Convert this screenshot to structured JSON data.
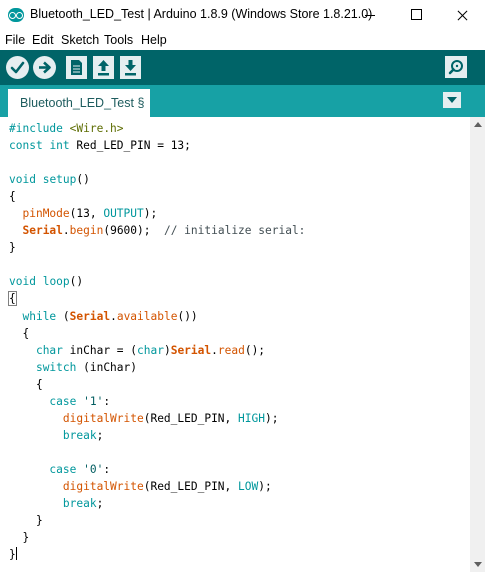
{
  "window": {
    "title": "Bluetooth_LED_Test | Arduino 1.8.9 (Windows Store 1.8.21.0)",
    "icon": "arduino-logo-icon",
    "controls": [
      "minimize-icon",
      "maximize-icon",
      "close-icon"
    ]
  },
  "menu": {
    "file": "File",
    "edit": "Edit",
    "sketch": "Sketch",
    "tools": "Tools",
    "help": "Help"
  },
  "toolbar": {
    "buttons": [
      "verify-icon",
      "upload-arrow-icon",
      "new-file-icon",
      "open-icon",
      "save-icon"
    ],
    "right_button": "serial-monitor-icon"
  },
  "tabs": [
    {
      "label": "Bluetooth_LED_Test §",
      "active": true
    }
  ],
  "editor": {
    "lines": [
      "#include <Wire.h>",
      "const int Red_LED_PIN = 13;",
      "",
      "void setup()",
      "{",
      "  pinMode(13, OUTPUT);",
      "  Serial.begin(9600);  // initialize serial:",
      "}",
      "",
      "void loop()",
      "{",
      "  while (Serial.available())",
      "  {",
      "    char inChar = (char)Serial.read();",
      "    switch (inChar)",
      "    {",
      "      case '1':",
      "        digitalWrite(Red_LED_PIN, HIGH);",
      "        break;",
      "",
      "      case '0':",
      "        digitalWrite(Red_LED_PIN, LOW);",
      "        break;",
      "    }",
      "  }",
      "}"
    ]
  },
  "colors": {
    "toolbar": "#006468",
    "tabstrip": "#17a1a5",
    "keyword": "#00979c",
    "function": "#d35400"
  }
}
